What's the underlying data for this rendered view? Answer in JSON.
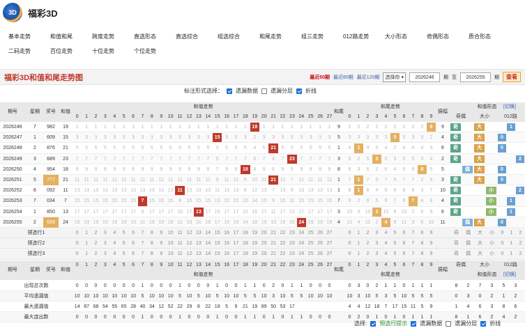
{
  "app": {
    "title": "福彩3D"
  },
  "nav": {
    "row1": [
      "基本走势",
      "和值和尾",
      "跨度走势",
      "直选形态",
      "直选综合",
      "组选综合",
      "和尾走势",
      "组三走势",
      "012路走势",
      "大小形态",
      "奇偶形态",
      "质合形态"
    ],
    "row2": [
      "二码走势",
      "百位走势",
      "十位走势",
      "个位走势"
    ]
  },
  "toolbar": {
    "title": "福彩3D和值和尾走势图",
    "links": [
      "最近50期",
      "最近80期",
      "最近120期"
    ],
    "select": "选择你",
    "from_value": "2026246",
    "from_label": "期",
    "to_label": "至",
    "to_value": "2026255",
    "to_unit": "期",
    "query": "查看"
  },
  "options": {
    "label": "标注形式选择：",
    "items": [
      {
        "label": "遗漏数据",
        "on": true
      },
      {
        "label": "遗漏分层",
        "on": false
      },
      {
        "label": "折线",
        "on": true
      }
    ]
  },
  "footer": {
    "label": "选择:",
    "items": [
      {
        "label": "预选行提示",
        "on": true
      },
      {
        "label": "遗漏数据",
        "on": true
      },
      {
        "label": "遗漏分层",
        "on": false
      },
      {
        "label": "折线",
        "on": true
      }
    ]
  },
  "table": {
    "head": {
      "qihao": "期号",
      "xingqi": "星期",
      "jianghao": "奖号",
      "hezhi": "和值",
      "hezhi_zs": "和值走势",
      "hewei": "和尾",
      "hewei_zs": "和尾走势",
      "zhenfu": "振幅",
      "xt": "和值形态",
      "xt_switch": "[切换]",
      "jiou": "奇偶",
      "daxiao": "大小",
      "l012": "012路"
    },
    "sums": [
      "0",
      "1",
      "2",
      "3",
      "4",
      "5",
      "6",
      "7",
      "8",
      "9",
      "10",
      "11",
      "12",
      "13",
      "14",
      "15",
      "16",
      "17",
      "18",
      "19",
      "20",
      "21",
      "22",
      "23",
      "24",
      "25",
      "26",
      "27"
    ],
    "digits": [
      "0",
      "1",
      "2",
      "3",
      "4",
      "5",
      "6",
      "7",
      "8",
      "9"
    ],
    "form_labels": [
      "奇",
      "偶",
      "大",
      "小",
      "0",
      "1",
      "2"
    ],
    "rows": [
      {
        "qihao": "2026246",
        "xingqi": "7",
        "jianghao": "982",
        "hezhi": "19",
        "hw": "9",
        "zf": "9",
        "jo": "奇",
        "dx": "大",
        "r": "1"
      },
      {
        "qihao": "2026247",
        "xingqi": "1",
        "jianghao": "609",
        "hezhi": "15",
        "hw": "5",
        "zf": "4",
        "jo": "奇",
        "dx": "大",
        "r": "0"
      },
      {
        "qihao": "2026248",
        "xingqi": "2",
        "jianghao": "876",
        "hezhi": "21",
        "hw": "1",
        "zf": "6",
        "jo": "奇",
        "dx": "大",
        "r": "0"
      },
      {
        "qihao": "2026249",
        "xingqi": "3",
        "jianghao": "689",
        "hezhi": "23",
        "hw": "3",
        "zf": "2",
        "jo": "奇",
        "dx": "大",
        "r": "2"
      },
      {
        "qihao": "2026250",
        "xingqi": "4",
        "jianghao": "954",
        "hezhi": "18",
        "hw": "8",
        "zf": "5",
        "jo": "偶",
        "dx": "大",
        "r": "0"
      },
      {
        "qihao": "2026251",
        "xingqi": "5",
        "jianghao": "777",
        "hezhi": "21",
        "hw": "1",
        "zf": "3",
        "jo": "奇",
        "dx": "大",
        "r": "0"
      },
      {
        "qihao": "2026252",
        "xingqi": "6",
        "jianghao": "092",
        "hezhi": "11",
        "hw": "1",
        "zf": "10",
        "jo": "奇",
        "dx": "小",
        "r": "2"
      },
      {
        "qihao": "2026253",
        "xingqi": "7",
        "jianghao": "034",
        "hezhi": "7",
        "hw": "7",
        "zf": "4",
        "jo": "奇",
        "dx": "小",
        "r": "1"
      },
      {
        "qihao": "2026254",
        "xingqi": "1",
        "jianghao": "850",
        "hezhi": "13",
        "hw": "3",
        "zf": "6",
        "jo": "奇",
        "dx": "小",
        "r": "1"
      },
      {
        "qihao": "2026255",
        "xingqi": "2",
        "jianghao": "699",
        "hezhi": "24",
        "hw": "4",
        "zf": "11",
        "jo": "偶",
        "dx": "大",
        "r": "0"
      }
    ],
    "preview": [
      "预选行1",
      "预选行2",
      "预选行3"
    ],
    "stats": [
      {
        "label": "出现总次数",
        "sums": "0 0 0 0 0 0 0 1 0 0 0 1 0 0 0 1 0 0 1 1 0 2 0 1 1 0 0 0",
        "tails": "0 3 0 2 1 1 0 1 1 1",
        "form": "8 2 7 3 5 3 2"
      },
      {
        "label": "平均遗漏值",
        "sums": "10 10 10 10 10 10 10 5 10 10 10 5 10 5 10 5 10 10 5 5 10 3 10 5 5 10 10 10",
        "tails": "10 3 10 5 3 5 10 5 5 5",
        "form": "0 3 0 2 1 2 1"
      },
      {
        "label": "最大遗漏值",
        "sums": "14 87 68 54 55 65 28 40 34 12 52 22 29 8 22 18 5 9 21 19 89 50 53 17",
        "tails": "4 4 12 18 7 17 15 11 5 9",
        "form": "1 4 6 3 8 6 7"
      },
      {
        "label": "最大连出数",
        "sums": "0 0 0 0 0 0 0 1 0 0 0 1 0 0 0 1 0 0 1 1 0 1 0 1 1 0 0 0",
        "tails": "0 2 0 1 0 1 0 1 1 1",
        "form": "8 1 6 2 4 2 1"
      }
    ]
  },
  "colors": {
    "accent": "#c0392b",
    "hit_sum": "#c0392b",
    "hit_tail": "#e3b061",
    "bar": "#e8e8e8",
    "form_bg": "#eef3f8",
    "odd_bg": "#f6f6f6"
  }
}
